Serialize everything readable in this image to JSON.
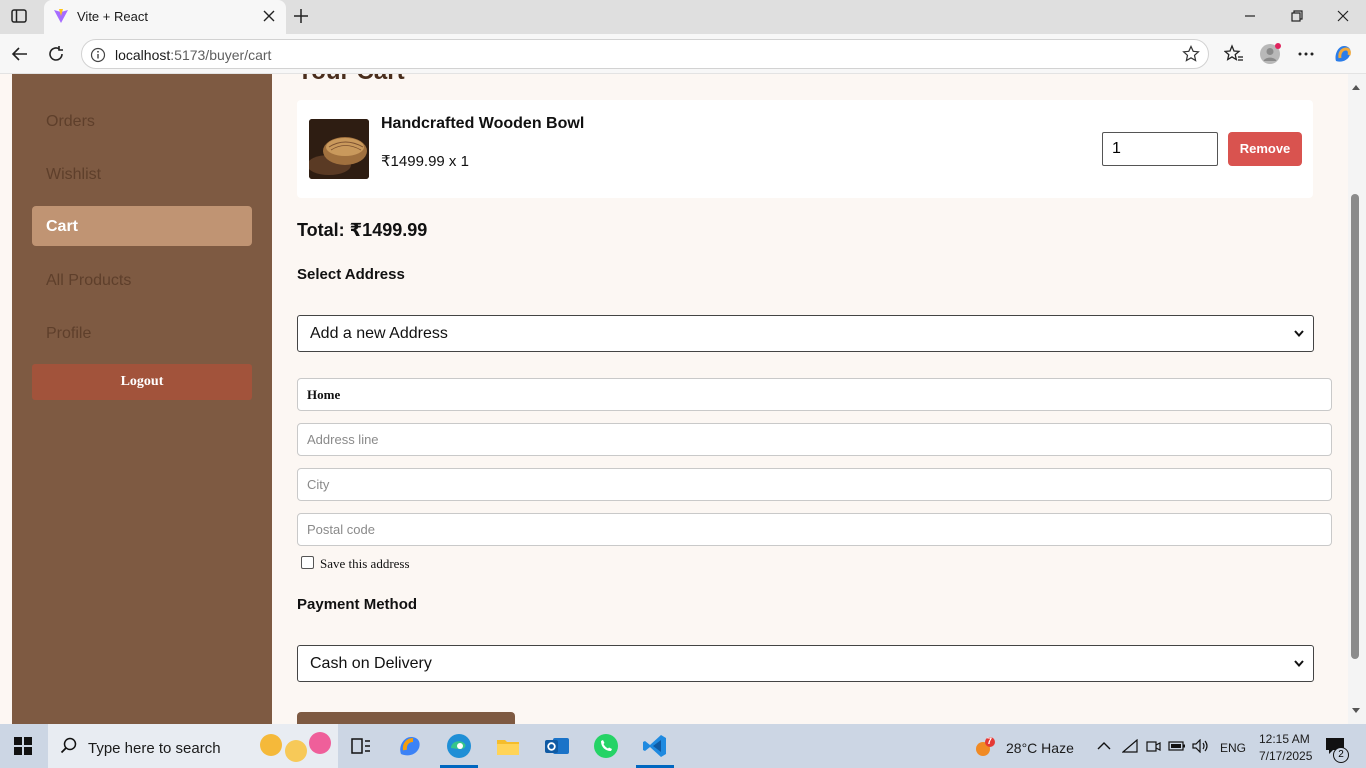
{
  "browser": {
    "tab_title": "Vite + React",
    "url_host": "localhost",
    "url_path": ":5173/buyer/cart"
  },
  "sidebar": {
    "items": [
      {
        "label": "Orders"
      },
      {
        "label": "Wishlist"
      },
      {
        "label": "Cart"
      },
      {
        "label": "All Products"
      },
      {
        "label": "Profile"
      }
    ],
    "logout_label": "Logout"
  },
  "cart": {
    "title": "Your Cart",
    "item": {
      "name": "Handcrafted Wooden Bowl",
      "price_line": "₹1499.99 x 1",
      "quantity": "1",
      "remove_label": "Remove"
    },
    "total": "Total: ₹1499.99"
  },
  "address": {
    "label": "Select Address",
    "selected": "Add a new Address",
    "fields": {
      "label_value": "Home",
      "address_line_placeholder": "Address line",
      "city_placeholder": "City",
      "postal_placeholder": "Postal code"
    },
    "save_label": "Save this address"
  },
  "payment": {
    "label": "Payment Method",
    "selected": "Cash on Delivery"
  },
  "taskbar": {
    "search_placeholder": "Type here to search",
    "weather": "28°C  Haze",
    "weather_badge": "7",
    "lang": "ENG",
    "time": "12:15 AM",
    "date": "7/17/2025",
    "notif_count": "2"
  },
  "colors": {
    "sidebar_bg": "#7e5a42",
    "active_item": "#c09473",
    "logout": "#a2533b",
    "remove": "#d9534f",
    "page_bg": "#fcf7f3"
  }
}
